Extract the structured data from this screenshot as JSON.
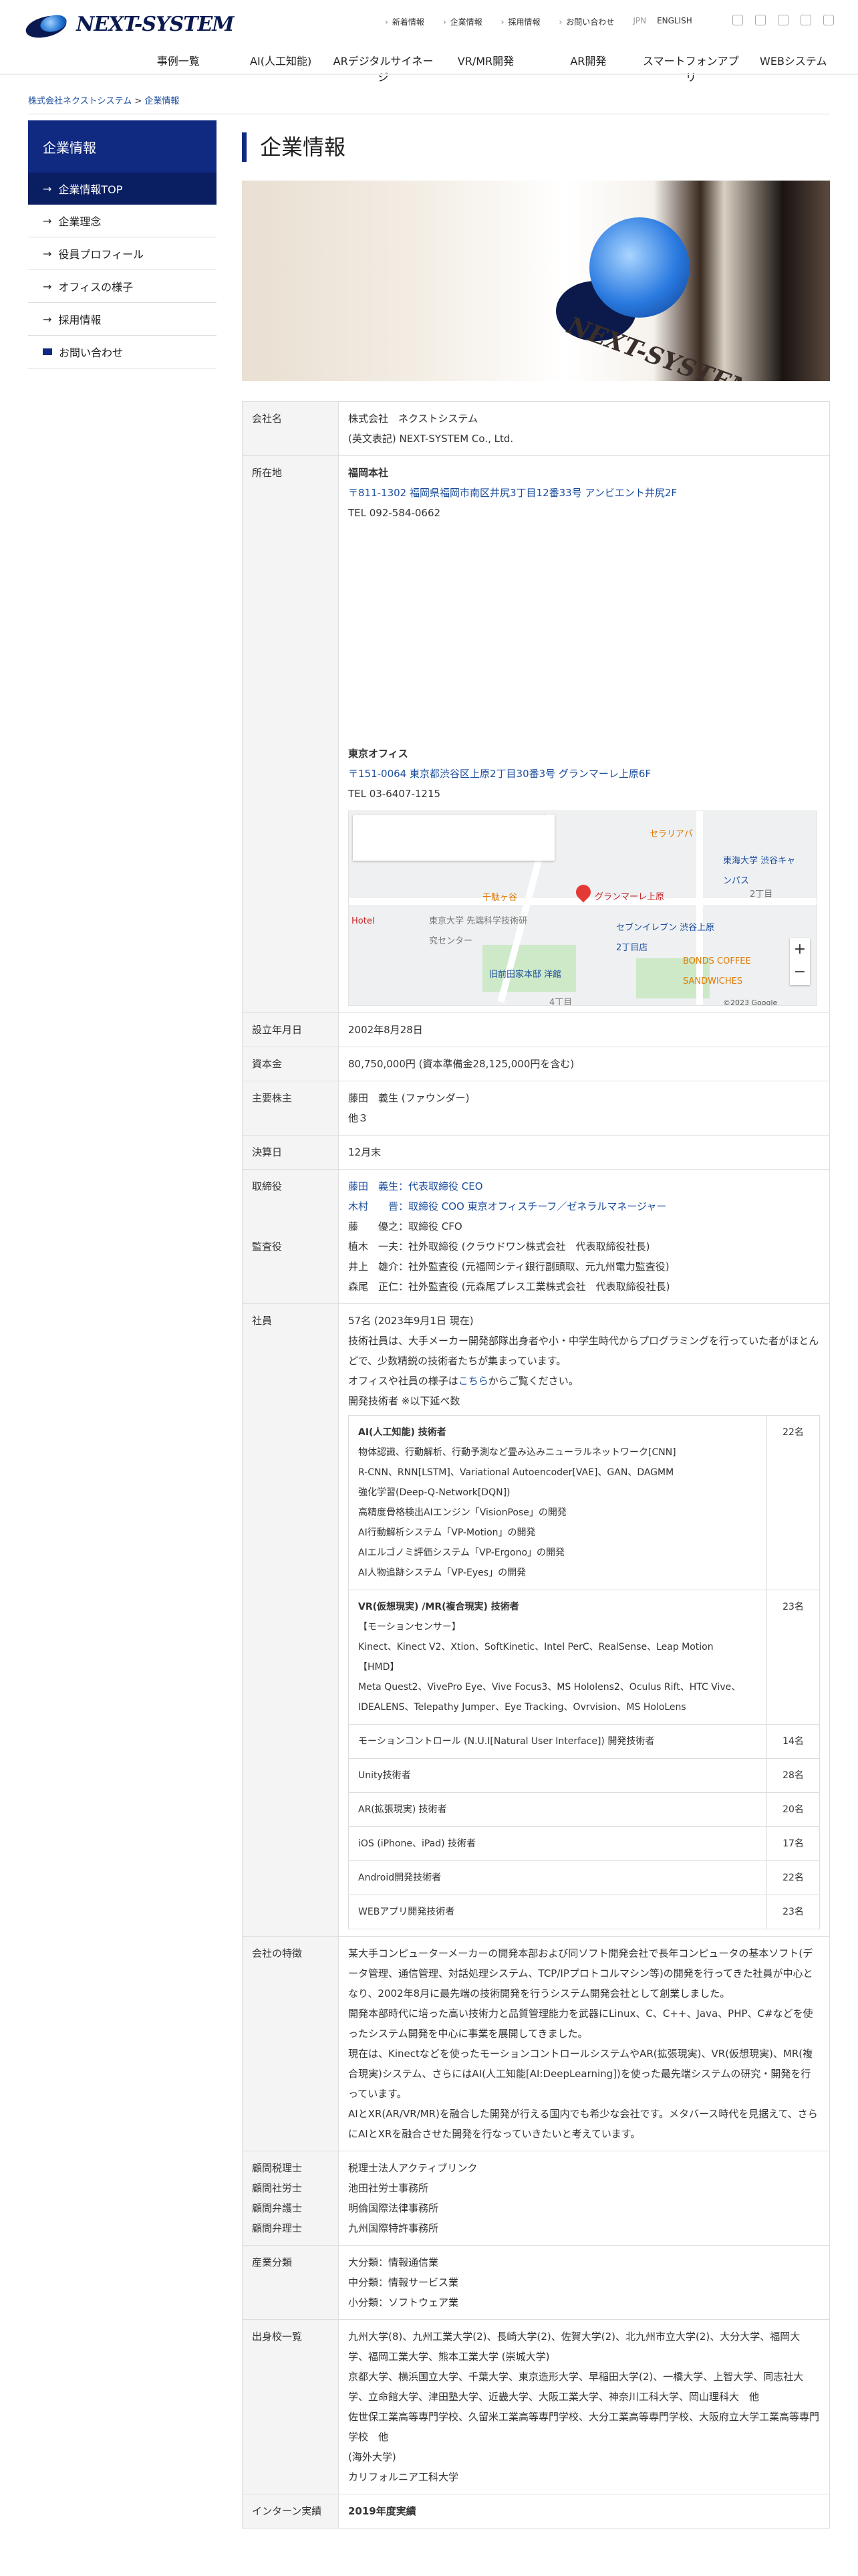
{
  "header": {
    "logo_text": "NEXT-SYSTEM",
    "top_links": [
      "新着情報",
      "企業情報",
      "採用情報",
      "お問い合わせ"
    ],
    "lang": [
      "JPN",
      "ENGLISH"
    ],
    "global_nav": [
      "事例一覧",
      "AI(人工知能)",
      "ARデジタルサイネージ",
      "VR/MR開発",
      "AR開発",
      "スマートフォンアプリ",
      "WEBシステム"
    ]
  },
  "breadcrumb": {
    "home": "株式会社ネクストシステム",
    "sep": ">",
    "current": "企業情報"
  },
  "sidebar": {
    "title": "企業情報",
    "items": [
      "企業情報TOP",
      "企業理念",
      "役員プロフィール",
      "オフィスの様子",
      "採用情報",
      "お問い合わせ"
    ]
  },
  "page": {
    "title": "企業情報",
    "hero_text": "NEXT-SYSTEM"
  },
  "info": {
    "company_label": "会社名",
    "company_name": "株式会社　ネクストシステム",
    "company_en": "(英文表記) NEXT-SYSTEM Co., Ltd.",
    "address_label": "所在地",
    "fukuoka_title": "福岡本社",
    "fukuoka_addr": "〒811-1302 福岡県福岡市南区井尻3丁目12番33号 アンビエント井尻2F",
    "fukuoka_tel": "TEL 092-584-0662",
    "tokyo_title": "東京オフィス",
    "tokyo_addr": "〒151-0064 東京都渋谷区上原2丁目30番3号 グランマーレ上原6F",
    "tokyo_tel": "TEL 03-6407-1215",
    "map_pin_label": "グランマーレ上原",
    "map_labels": [
      "セラリアパ",
      "東海大学 渋谷キャンパス",
      "千駄ヶ谷",
      "セブンイレブン 渋谷上原2丁目店",
      "BONDS COFFEE SANDWICHES",
      "東京大学 先端科学技術研究センター",
      "旧前田家本邸 洋館",
      "Hotel",
      "2丁目",
      "4丁目"
    ],
    "map_copyright": "©2023 Google",
    "founded_label": "設立年月日",
    "founded": "2002年8月28日",
    "capital_label": "資本金",
    "capital": "80,750,000円 (資本準備金28,125,000円を含む)",
    "holders_label": "主要株主",
    "holders": [
      "藤田　義生 (ファウンダー)",
      "他３"
    ],
    "fiscal_label": "決算日",
    "fiscal": "12月末",
    "directors_label": "取締役",
    "auditors_label": "監査役",
    "officers": [
      {
        "text": "藤田　義生：代表取締役 CEO",
        "link": true
      },
      {
        "text": "木村　　晋：取締役 COO 東京オフィスチーフ／ゼネラルマネージャー",
        "link": true
      },
      {
        "text": "藤　　優之：取締役 CFO",
        "link": false
      },
      {
        "text": "植木　一夫：社外取締役 (クラウドワン株式会社　代表取締役社長)",
        "link": false
      },
      {
        "text": "井上　雄介：社外監査役 (元福岡シティ銀行副頭取、元九州電力監査役)",
        "link": false
      },
      {
        "text": "森尾　正仁：社外監査役 (元森尾プレス工業株式会社　代表取締役社長)",
        "link": false
      }
    ],
    "staff_label": "社員",
    "staff_count": "57名 (2023年9月1日 現在)",
    "staff_desc1": "技術社員は、大手メーカー開発部隊出身者や小・中学生時代からプログラミングを行っていた者がほとんどで、少数精鋭の技術者たちが集まっています。",
    "staff_desc2_pre": "オフィスや社員の様子は",
    "staff_desc2_link": "こちら",
    "staff_desc2_post": "からご覧ください。",
    "staff_note": "開発技術者 ※以下延べ数",
    "engineers": [
      {
        "title": "AI(人工知能) 技術者",
        "count": "22名",
        "lines": [
          "物体認識、行動解析、行動予測など畳み込みニューラルネットワーク[CNN]",
          "R-CNN、RNN[LSTM]、Variational Autoencoder[VAE]、GAN、DAGMM",
          "強化学習(Deep-Q-Network[DQN])",
          "高精度骨格検出AIエンジン「VisionPose」の開発",
          "AI行動解析システム「VP-Motion」の開発",
          "AIエルゴノミ評価システム「VP-Ergono」の開発",
          "AI人物追跡システム「VP-Eyes」の開発"
        ]
      },
      {
        "title": "VR(仮想現実) /MR(複合現実) 技術者",
        "count": "23名",
        "lines": [
          "【モーションセンサー】",
          "Kinect、Kinect V2、Xtion、SoftKinetic、Intel PerC、RealSense、Leap Motion",
          "【HMD】",
          "Meta Quest2、VivePro Eye、Vive Focus3、MS Hololens2、Oculus Rift、HTC Vive、IDEALENS、Telepathy Jumper、Eye Tracking、Ovrvision、MS HoloLens"
        ]
      },
      {
        "title": "モーションコントロール (N.U.I[Natural User Interface]) 開発技術者",
        "count": "14名",
        "lines": []
      },
      {
        "title": "Unity技術者",
        "count": "28名",
        "lines": []
      },
      {
        "title": "AR(拡張現実) 技術者",
        "count": "20名",
        "lines": []
      },
      {
        "title": "iOS (iPhone、iPad) 技術者",
        "count": "17名",
        "lines": []
      },
      {
        "title": "Android開発技術者",
        "count": "22名",
        "lines": []
      },
      {
        "title": "WEBアプリ開発技術者",
        "count": "23名",
        "lines": []
      }
    ],
    "features_label": "会社の特徴",
    "features": [
      "某大手コンピューターメーカーの開発本部および同ソフト開発会社で長年コンピュータの基本ソフト(データ管理、通信管理、対話処理システム、TCP/IPプロトコルマシン等)の開発を行ってきた社員が中心となり、2002年8月に最先端の技術開発を行うシステム開発会社として創業しました。",
      "開発本部時代に培った高い技術力と品質管理能力を武器にLinux、C、C++、Java、PHP、C#などを使ったシステム開発を中心に事業を展開してきました。",
      "現在は、Kinectなどを使ったモーションコントロールシステムやAR(拡張現実)、VR(仮想現実)、MR(複合現実)システム、さらにはAI(人工知能[AI:DeepLearning])を使った最先端システムの研究・開発を行っています。",
      "AIとXR(AR/VR/MR)を融合した開発が行える国内でも希少な会社です。メタバース時代を見据えて、さらにAIとXRを融合させた開発を行なっていきたいと考えています。"
    ],
    "advisors_labels": [
      "顧問税理士",
      "顧問社労士",
      "顧問弁護士",
      "顧問弁理士"
    ],
    "advisors": [
      "税理士法人アクティブリンク",
      "池田社労士事務所",
      "明倫国際法律事務所",
      "九州国際特許事務所"
    ],
    "industry_label": "産業分類",
    "industry": [
      "大分類：情報通信業",
      "中分類：情報サービス業",
      "小分類：ソフトウェア業"
    ],
    "schools_label": "出身校一覧",
    "schools": [
      "九州大学(8)、九州工業大学(2)、長崎大学(2)、佐賀大学(2)、北九州市立大学(2)、大分大学、福岡大学、福岡工業大学、熊本工業大学 (崇城大学)",
      "京都大学、横浜国立大学、千葉大学、東京造形大学、早稲田大学(2)、一橋大学、上智大学、同志社大学、立命館大学、津田塾大学、近畿大学、大阪工業大学、神奈川工科大学、岡山理科大　他",
      "佐世保工業高等専門学校、久留米工業高等専門学校、大分工業高等専門学校、大阪府立大学工業高等専門学校　他",
      "(海外大学)",
      "カリフォルニア工科大学"
    ],
    "intern_label": "インターン実績",
    "intern": "2019年度実績"
  }
}
